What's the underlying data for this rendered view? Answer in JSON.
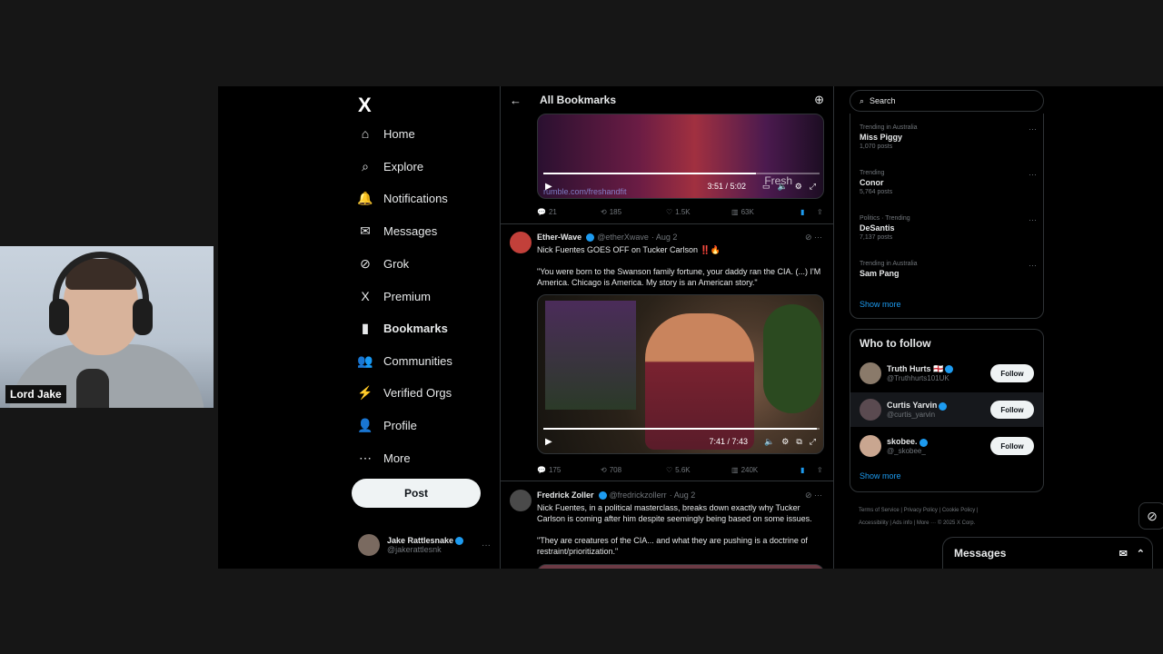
{
  "webcam": {
    "label": "Lord Jake"
  },
  "nav": {
    "logo": "X",
    "items": [
      {
        "label": "Home",
        "icon": "⌂",
        "active": false
      },
      {
        "label": "Explore",
        "icon": "⌕",
        "active": false
      },
      {
        "label": "Notifications",
        "icon": "🔔",
        "active": false
      },
      {
        "label": "Messages",
        "icon": "✉",
        "active": false
      },
      {
        "label": "Grok",
        "icon": "⊘",
        "active": false
      },
      {
        "label": "Premium",
        "icon": "X",
        "active": false
      },
      {
        "label": "Bookmarks",
        "icon": "▮",
        "active": true
      },
      {
        "label": "Communities",
        "icon": "👥",
        "active": false
      },
      {
        "label": "Verified Orgs",
        "icon": "⚡",
        "active": false
      },
      {
        "label": "Profile",
        "icon": "👤",
        "active": false
      },
      {
        "label": "More",
        "icon": "⋯",
        "active": false
      }
    ],
    "post_label": "Post",
    "account": {
      "name": "Jake Rattlesnake",
      "handle": "@jakerattlesnk"
    }
  },
  "timeline": {
    "title": "All Bookmarks",
    "video1": {
      "url": "rumble.com/freshandfit",
      "time": "3:51 / 5:02",
      "watermark": "Fresh",
      "progress": 0.77
    },
    "tweet1_stats": {
      "replies": "21",
      "reposts": "185",
      "likes": "1.5K",
      "views": "63K"
    },
    "tweet2": {
      "author": "Ether-Wave",
      "handle": "@etherXwave",
      "date": "· Aug 2",
      "line1": "Nick Fuentes GOES OFF on Tucker Carlson ‼️🔥",
      "quote": "\"You were born to the Swanson family fortune, your daddy ran the CIA. (...) I'M America. Chicago is America. My story is an American story.\"",
      "video_time": "7:41 / 7:43",
      "progress": 0.99,
      "stats": {
        "replies": "175",
        "reposts": "708",
        "likes": "5.6K",
        "views": "240K"
      }
    },
    "tweet3": {
      "author": "Fredrick Zoller",
      "handle": "@fredrickzollerr",
      "date": "· Aug 2",
      "line1": "Nick Fuentes, in a political masterclass, breaks down exactly why Tucker Carlson is coming after him despite seemingly being based on some issues.",
      "quote": "\"They are creatures of the CIA... and what they are pushing is a doctrine of restraint/prioritization.\""
    }
  },
  "right": {
    "search_placeholder": "Search",
    "trends": [
      {
        "context": "Trending in Australia",
        "name": "Miss Piggy",
        "count": "1,070 posts"
      },
      {
        "context": "Trending",
        "name": "Conor",
        "count": "5,764 posts"
      },
      {
        "context": "Politics · Trending",
        "name": "DeSantis",
        "count": "7,137 posts"
      },
      {
        "context": "Trending in Australia",
        "name": "Sam Pang",
        "count": ""
      }
    ],
    "show_more": "Show more",
    "who_to_follow": {
      "title": "Who to follow",
      "accounts": [
        {
          "name": "Truth Hurts 🏴󠁧󠁢󠁥󠁮󠁧󠁿",
          "handle": "@Truthhurts101UK",
          "button": "Follow"
        },
        {
          "name": "Curtis Yarvin",
          "handle": "@curtis_yarvin",
          "button": "Follow"
        },
        {
          "name": "skobee.",
          "handle": "@_skobee_",
          "button": "Follow"
        }
      ],
      "show_more": "Show more"
    },
    "footer": [
      "Terms of Service",
      "Privacy Policy",
      "Cookie Policy",
      "Accessibility",
      "Ads info",
      "More ···",
      "© 2025 X Corp."
    ]
  },
  "messages_dock": {
    "title": "Messages"
  },
  "colors": {
    "accent": "#1d9bf0",
    "background": "#000000",
    "border": "#2f3336",
    "muted": "#71767b"
  }
}
